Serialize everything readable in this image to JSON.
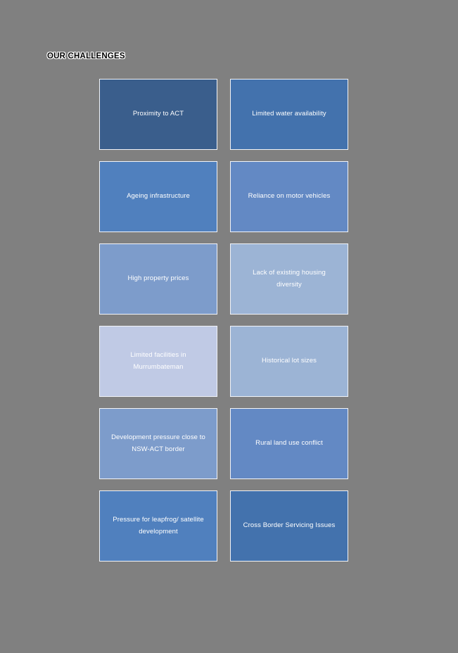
{
  "page": {
    "title": "OUR CHALLENGES",
    "background_color": "#808080",
    "title_color": "#000000",
    "title_outline_color": "#ffffff",
    "card_border_color": "#f2f4f8",
    "card_text_color": "#ffffff"
  },
  "challenges": [
    {
      "label": "Proximity to ACT",
      "color": "#3A5E8C"
    },
    {
      "label": "Limited water availability",
      "color": "#4372AD"
    },
    {
      "label": "Ageing infrastructure",
      "color": "#5080BE"
    },
    {
      "label": "Reliance on motor vehicles",
      "color": "#6389C4"
    },
    {
      "label": "High property prices",
      "color": "#7D9CCB"
    },
    {
      "label": "Lack of existing housing diversity",
      "color": "#9CB4D5"
    },
    {
      "label": "Limited facilities in Murrumbateman",
      "color": "#C0CAE5"
    },
    {
      "label": "Historical lot sizes",
      "color": "#9CB4D5"
    },
    {
      "label": "Development pressure close to NSW-ACT border",
      "color": "#7D9CCB"
    },
    {
      "label": "Rural land use conflict",
      "color": "#6389C4"
    },
    {
      "label": "Pressure for leapfrog/ satellite development",
      "color": "#5080BE"
    },
    {
      "label": "Cross Border Servicing Issues",
      "color": "#4372AD"
    }
  ]
}
